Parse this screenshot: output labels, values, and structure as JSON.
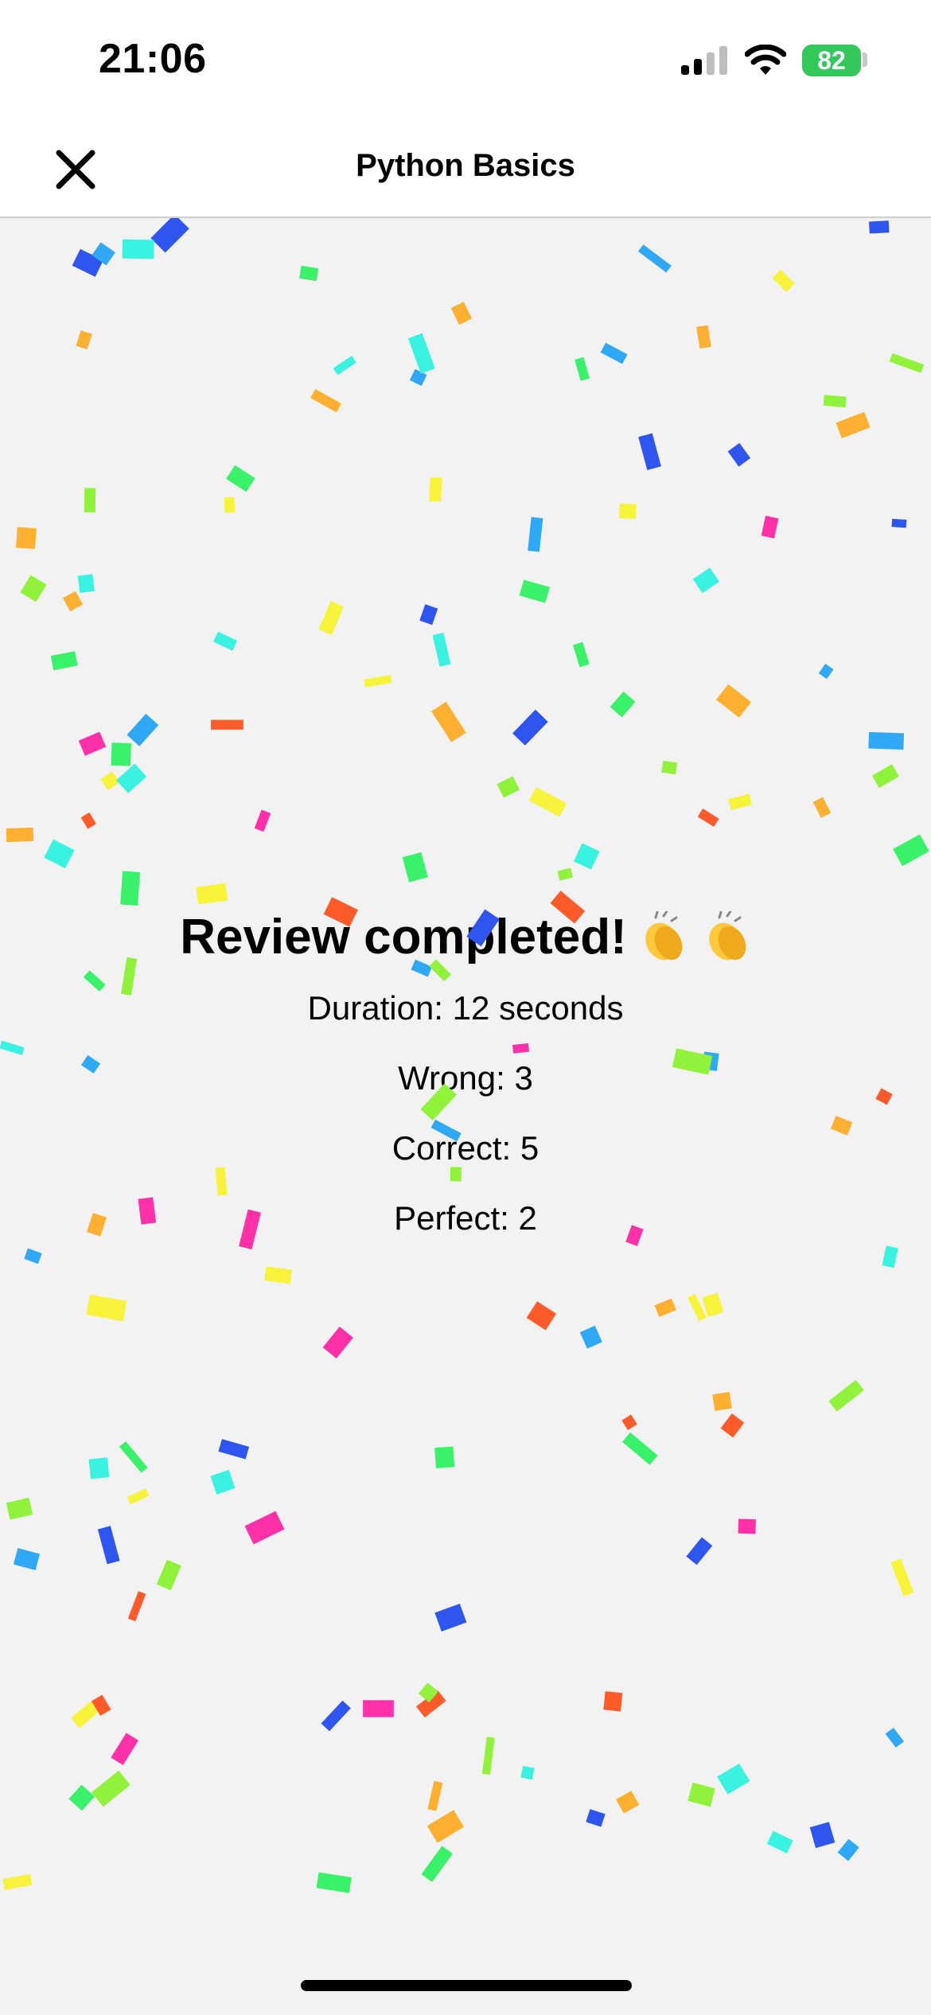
{
  "status_bar": {
    "time": "21:06",
    "battery_percent": "82",
    "battery_color": "#34c759"
  },
  "nav": {
    "title": "Python Basics",
    "close_icon": "close-icon"
  },
  "summary": {
    "heading": "Review completed!",
    "heading_emoji": "clapping-hands-icon",
    "stats": {
      "duration": "Duration: 12 seconds",
      "wrong": "Wrong: 3",
      "correct": "Correct: 5",
      "perfect": "Perfect: 2"
    }
  },
  "confetti_colors": [
    "#ffb030",
    "#ff5a2a",
    "#f7f23a",
    "#90f23a",
    "#3af26a",
    "#3af2e0",
    "#2fa8f5",
    "#2f55f0",
    "#ff30a8"
  ]
}
